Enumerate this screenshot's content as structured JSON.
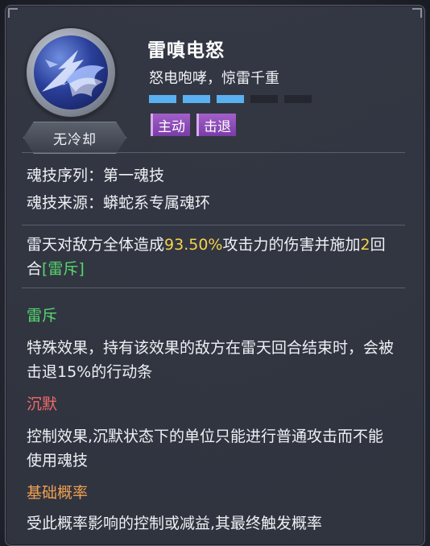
{
  "skill": {
    "name": "雷嗔电怒",
    "subtitle": "怒电咆哮，惊雷千重",
    "cooldown_label": "无冷却",
    "level_filled": 3,
    "level_total": 5,
    "tags": [
      "主动",
      "击退"
    ]
  },
  "info": {
    "sequence": "魂技序列：第一魂技",
    "source": "魂技来源：蟒蛇系专属魂环"
  },
  "description": {
    "part1": "雷天对敌方全体造成",
    "percent": "93.50%",
    "part2": "攻击力的伤害并施加",
    "turns": "2",
    "part3": "回合",
    "effect_link": "[雷斥]"
  },
  "effects": [
    {
      "title": "雷斥",
      "text": "特殊效果，持有该效果的敌方在雷天回合结束时，会被击退15%的行动条"
    },
    {
      "title": "沉默",
      "text": "控制效果,沉默状态下的单位只能进行普通攻击而不能使用魂技"
    },
    {
      "title": "基础概率",
      "text": "受此概率影响的控制或减益,其最终触发概率"
    }
  ],
  "colors": {
    "accent_blue": "#5ab0f0",
    "highlight_yellow": "#f6d24a",
    "green": "#55d66f",
    "red": "#f06a6a",
    "orange": "#f0a050",
    "tag_purple": "#8a4cb8"
  }
}
